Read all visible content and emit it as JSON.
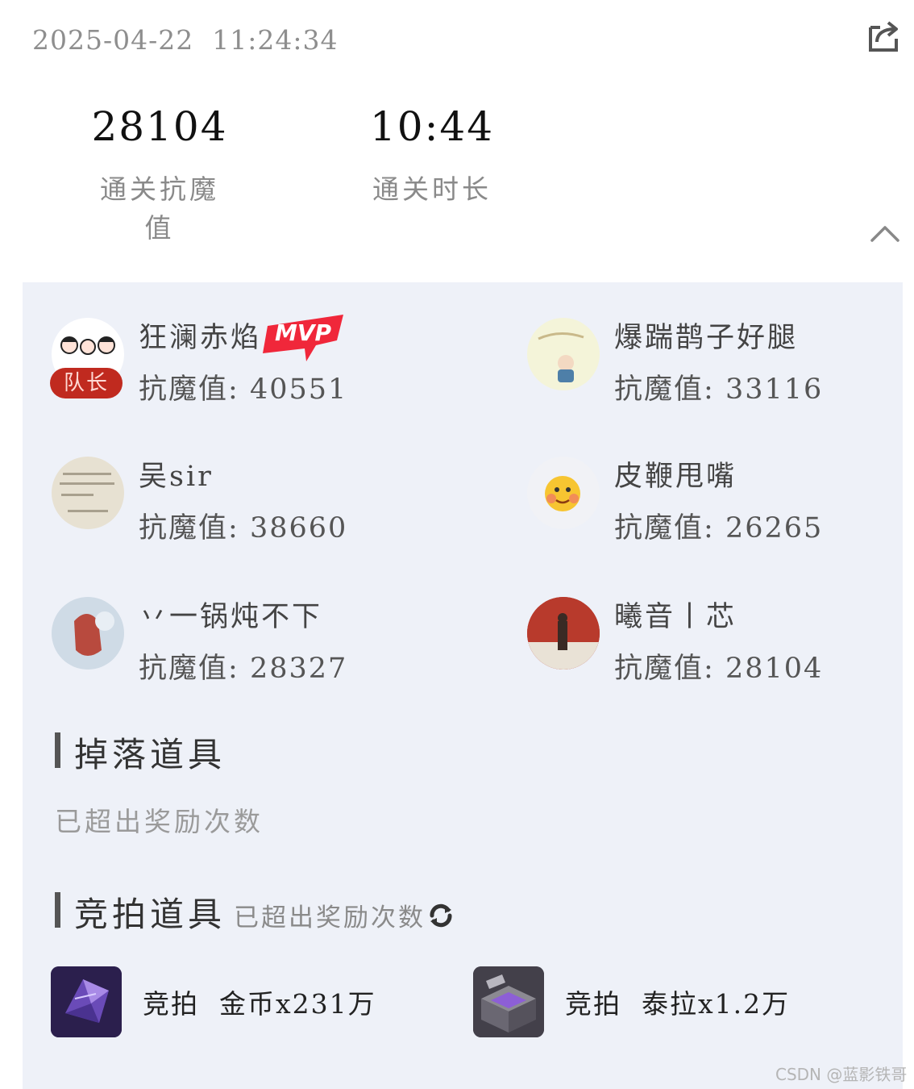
{
  "header": {
    "timestamp": "2025-04-22  11:24:34",
    "share_icon": "share-export-icon"
  },
  "stats": [
    {
      "value": "28104",
      "label": "通关抗魔值"
    },
    {
      "value": "10:44",
      "label": "通关时长"
    }
  ],
  "collapse_icon": "chevron-up-icon",
  "players": [
    {
      "name": "狂澜赤焰",
      "score_label": "抗魔值:",
      "score": "40551",
      "captain_badge": "队长",
      "mvp_badge": "MVP"
    },
    {
      "name": "爆踹鹊子好腿",
      "score_label": "抗魔值:",
      "score": "33116"
    },
    {
      "name": "吴sir",
      "score_label": "抗魔值:",
      "score": "38660"
    },
    {
      "name": "皮鞭甩嘴",
      "score_label": "抗魔值:",
      "score": "26265"
    },
    {
      "name": "丷一锅炖不下",
      "score_label": "抗魔值:",
      "score": "28327"
    },
    {
      "name": "曦音丨芯",
      "score_label": "抗魔值:",
      "score": "28104"
    }
  ],
  "drops": {
    "title": "掉落道具",
    "note": "已超出奖励次数"
  },
  "auction": {
    "title": "竞拍道具",
    "note": "已超出奖励次数",
    "refresh_icon": "refresh-icon",
    "items": [
      {
        "text": "竞拍  金币x231万",
        "icon": "crystal-item-icon"
      },
      {
        "text": "竞拍  泰拉x1.2万",
        "icon": "box-item-icon"
      }
    ]
  },
  "watermark": "CSDN @蓝影铁哥"
}
